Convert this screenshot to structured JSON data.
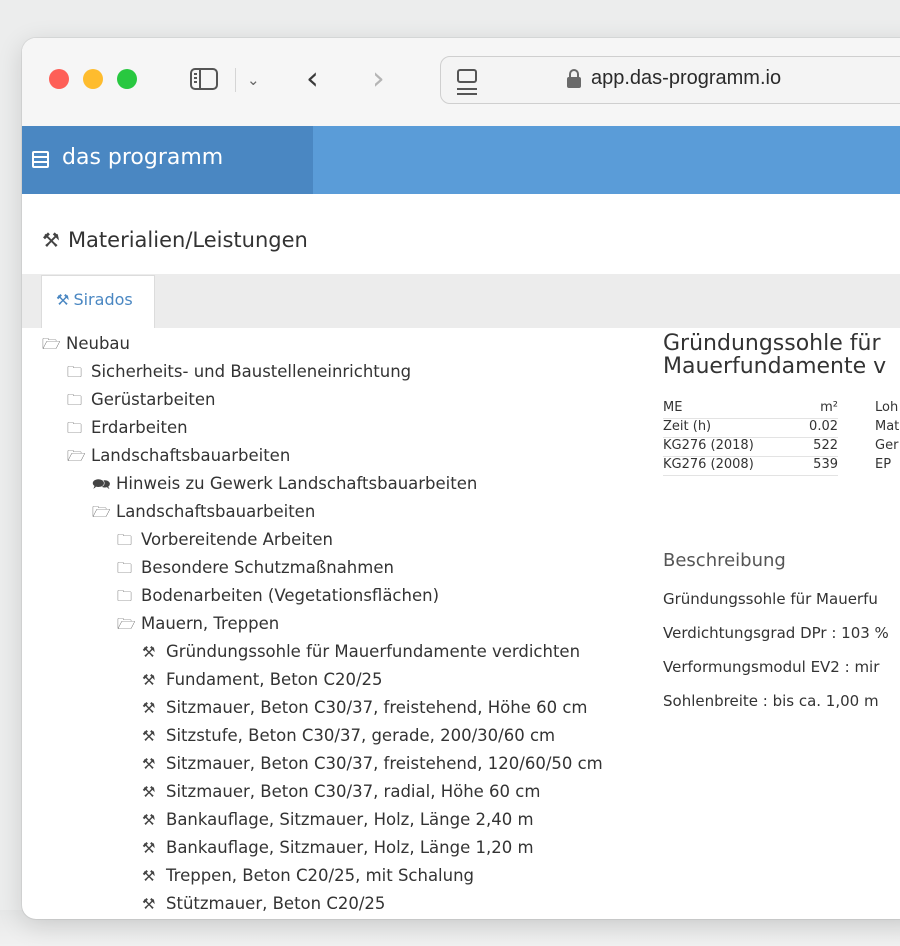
{
  "browser": {
    "url": "app.das-programm.io"
  },
  "app": {
    "brand": "das programm"
  },
  "page": {
    "title": "Materialien/Leistungen",
    "tab": "Sirados"
  },
  "tree": [
    {
      "label": "Neubau",
      "icon": "folder-open-icon",
      "level": 0
    },
    {
      "label": "Sicherheits- und Baustelleneinrichtung",
      "icon": "folder-icon",
      "level": 1
    },
    {
      "label": "Gerüstarbeiten",
      "icon": "folder-icon",
      "level": 1
    },
    {
      "label": "Erdarbeiten",
      "icon": "folder-icon",
      "level": 1
    },
    {
      "label": "Landschaftsbauarbeiten",
      "icon": "folder-open-icon",
      "level": 1
    },
    {
      "label": "Hinweis zu Gewerk Landschaftsbauarbeiten",
      "icon": "comments-icon",
      "level": 2
    },
    {
      "label": "Landschaftsbauarbeiten",
      "icon": "folder-open-icon",
      "level": 2
    },
    {
      "label": "Vorbereitende Arbeiten",
      "icon": "folder-icon",
      "level": 3
    },
    {
      "label": "Besondere Schutzmaßnahmen",
      "icon": "folder-icon",
      "level": 3
    },
    {
      "label": "Bodenarbeiten (Vegetationsflächen)",
      "icon": "folder-icon",
      "level": 3
    },
    {
      "label": "Mauern, Treppen",
      "icon": "folder-open-icon",
      "level": 3
    },
    {
      "label": "Gründungssohle für Mauerfundamente verdichten",
      "icon": "hammer-icon",
      "level": 4
    },
    {
      "label": "Fundament, Beton C20/25",
      "icon": "hammer-icon",
      "level": 4
    },
    {
      "label": "Sitzmauer, Beton C30/37, freistehend, Höhe 60 cm",
      "icon": "hammer-icon",
      "level": 4
    },
    {
      "label": "Sitzstufe, Beton C30/37, gerade, 200/30/60 cm",
      "icon": "hammer-icon",
      "level": 4
    },
    {
      "label": "Sitzmauer, Beton C30/37, freistehend, 120/60/50 cm",
      "icon": "hammer-icon",
      "level": 4
    },
    {
      "label": "Sitzmauer, Beton C30/37, radial, Höhe 60 cm",
      "icon": "hammer-icon",
      "level": 4
    },
    {
      "label": "Bankauflage, Sitzmauer, Holz, Länge 2,40 m",
      "icon": "hammer-icon",
      "level": 4
    },
    {
      "label": "Bankauflage, Sitzmauer, Holz, Länge 1,20 m",
      "icon": "hammer-icon",
      "level": 4
    },
    {
      "label": "Treppen, Beton C20/25, mit Schalung",
      "icon": "hammer-icon",
      "level": 4
    },
    {
      "label": "Stützmauer, Beton C20/25",
      "icon": "hammer-icon",
      "level": 4
    }
  ],
  "detail": {
    "title_line1": "Gründungssohle für",
    "title_line2": "Mauerfundamente v",
    "table": [
      {
        "key": "ME",
        "value": "m²",
        "right": "Loh"
      },
      {
        "key": "Zeit (h)",
        "value": "0.02",
        "right": "Mat"
      },
      {
        "key": "KG276 (2018)",
        "value": "522",
        "right": "Ger"
      },
      {
        "key": "KG276 (2008)",
        "value": "539",
        "right": "EP"
      }
    ],
    "description_heading": "Beschreibung",
    "description": [
      "Gründungssohle für Mauerfu",
      "Verdichtungsgrad DPr : 103 %",
      "Verformungsmodul EV2 : mir",
      "Sohlenbreite : bis ca. 1,00 m"
    ]
  }
}
